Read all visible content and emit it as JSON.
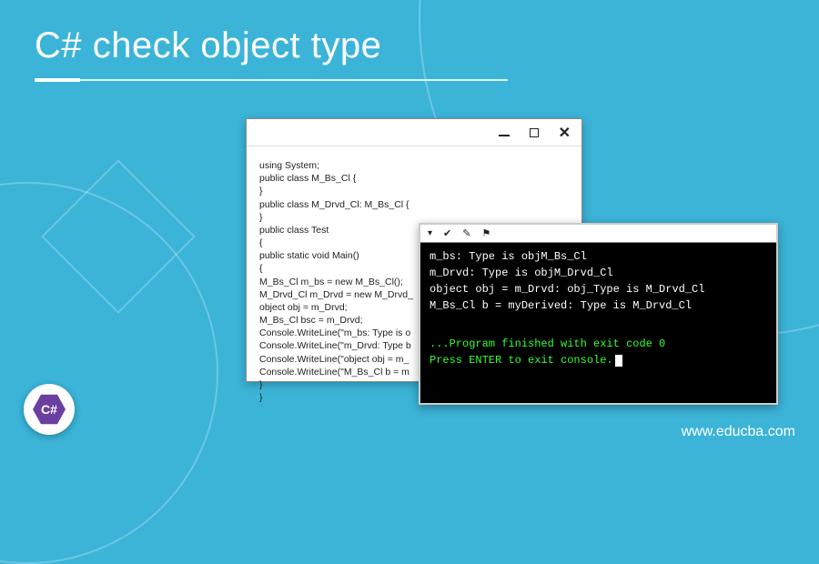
{
  "title": "C# check object type",
  "logo_text": "C#",
  "site_url": "www.educba.com",
  "code_window": {
    "lines": [
      "using System;",
      "public class M_Bs_Cl {",
      "}",
      "public class M_Drvd_Cl: M_Bs_Cl {",
      "}",
      "public class Test",
      "{",
      "public static void Main()",
      "{",
      "M_Bs_Cl m_bs = new M_Bs_Cl();",
      "M_Drvd_Cl m_Drvd = new M_Drvd_",
      "object obj = m_Drvd;",
      "M_Bs_Cl bsc = m_Drvd;",
      "Console.WriteLine(\"m_bs: Type is o",
      "Console.WriteLine(\"m_Drvd: Type b",
      "Console.WriteLine(\"object obj = m_",
      "Console.WriteLine(\"M_Bs_Cl b = m",
      "}",
      "}"
    ]
  },
  "console": {
    "toolbar_icons": [
      "✔",
      "✎",
      "⚑"
    ],
    "lines": [
      "m_bs: Type is objM_Bs_Cl",
      "m_Drvd: Type is objM_Drvd_Cl",
      "object obj = m_Drvd: obj_Type is M_Drvd_Cl",
      "M_Bs_Cl b = myDerived: Type is M_Drvd_Cl"
    ],
    "exit_line": "...Program finished with exit code 0",
    "prompt_line": "Press ENTER to exit console."
  }
}
